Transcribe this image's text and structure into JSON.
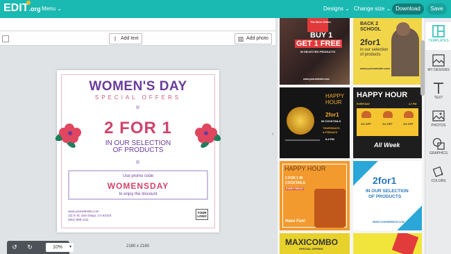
{
  "topbar": {
    "logo": "EDIT",
    "logo_suffix": ".org",
    "menu": "Menu",
    "designs": "Designs",
    "change_size": "Change size",
    "download": "Download",
    "save": "Save"
  },
  "toolbar": {
    "add_text": "Add text",
    "add_photo": "Add photo"
  },
  "design": {
    "title": "WOMEN'S DAY",
    "subtitle": "SPECIAL OFFERS",
    "headline": "2 FOR 1",
    "line1": "IN OUR SELECTION",
    "line2": "OF PRODUCTS",
    "promo_label": "Use promo code",
    "promo_code": "WOMENSDAY",
    "enjoy": "to enjoy the discount",
    "address1": "www.yourwebsite.com",
    "address2": "111 E St, San Diego, CA 92103",
    "address3": "(651) 888-1111",
    "logo_line1": "YOUR",
    "logo_line2": "LOGO"
  },
  "canvas": {
    "dimensions": "2160 x 2160",
    "zoom": "10%"
  },
  "gallery": {
    "t1_small": "The Best Offers",
    "t1_big1": "BUY 1",
    "t1_big2": "GET 1 FREE",
    "t1_sub": "IN SELECTED PRODUCTS",
    "t1_url": "www.yourwebsite.com",
    "t2_a": "BACK 2",
    "t2_b": "SCHOOL",
    "t2_c": "2for1",
    "t2_d": "in our selection",
    "t2_e": "of products",
    "t2_url": "www.yourwebsite.com",
    "t3_a": "HAPPY",
    "t3_b": "HOUR",
    "t3_c": "2for1",
    "t3_d": "IN COCKTAILS",
    "t3_e": "THURSDAYS",
    "t3_f": "& FRIDAYS",
    "t3_g": "8-9 PM",
    "t4_a": "HAPPY HOUR",
    "t4_b": "EVERYDAY",
    "t4_c": "4-7 PM",
    "t4_p1": "1/2 OFF",
    "t4_p2": "1/2 OFF",
    "t4_p3": "1/2 OFF",
    "t4_d": "All Week",
    "t5_a": "HAPPY HOUR",
    "t5_b": "2 FOR 1 IN",
    "t5_c": "COCKTAILS",
    "t5_d": "EVERY FRIDAY",
    "t5_e": "Have Fun!",
    "t6_a": "2for1",
    "t6_b": "IN OUR SELECTION",
    "t6_c": "OF PRODUCTS",
    "t6_url": "WWW.YOURWEBSITE.COM",
    "t7_a": "MAXICOMBO",
    "t7_b": "SPECIAL OFFERS"
  },
  "sidebar": {
    "templates": "TEMPLATES",
    "my_designs": "MY DESIGNS",
    "text": "TEXT",
    "photos": "PHOTOS",
    "graphics": "GRAPHICS",
    "colors": "COLORS"
  },
  "colors": {
    "accent": "#1ab9b2",
    "purple": "#6a3b9a",
    "pink": "#cf4469"
  }
}
